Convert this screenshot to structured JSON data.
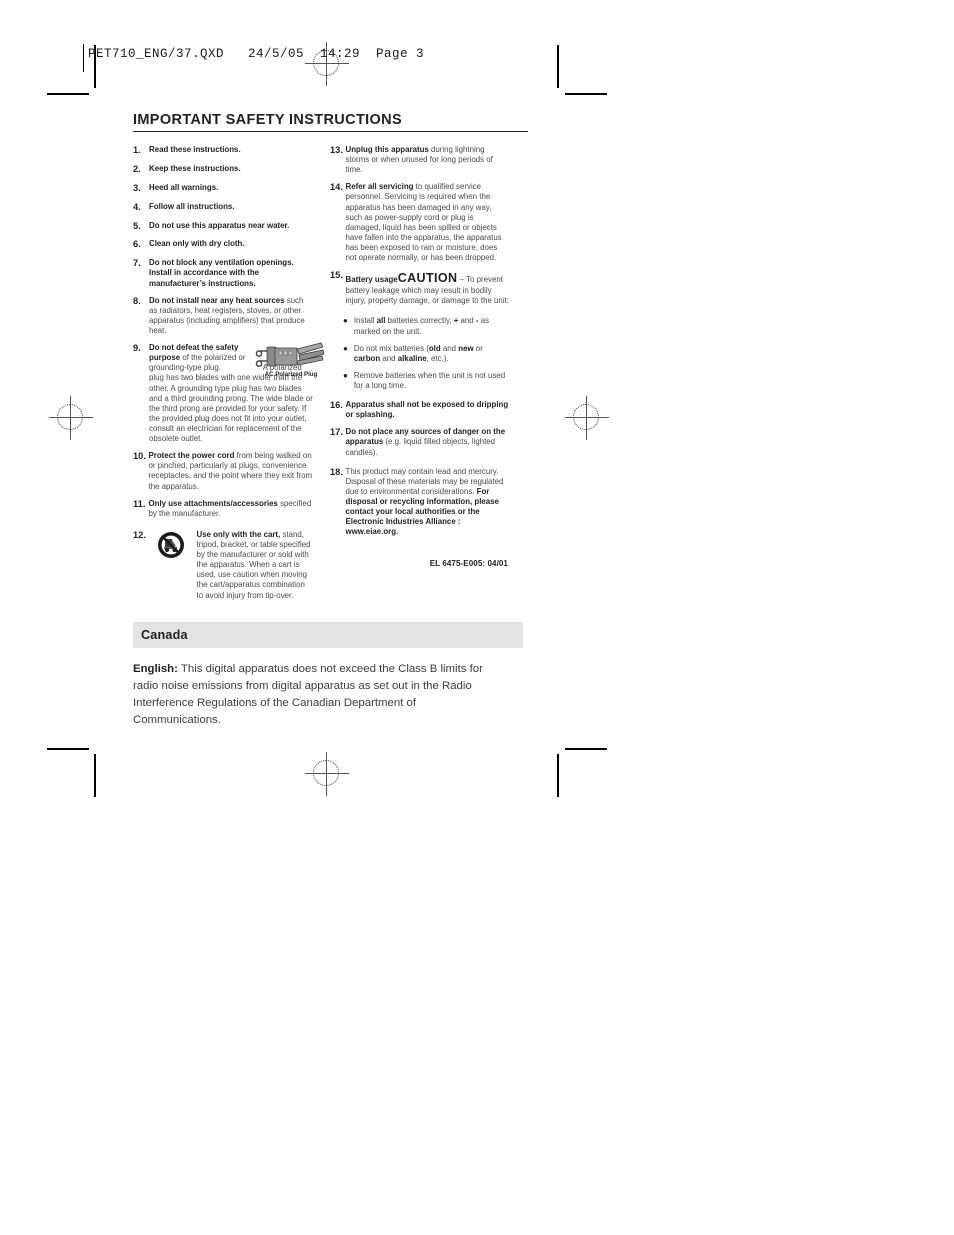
{
  "print_header": {
    "file_info": "PET710_ENG/37.QXD   24/5/05  14:29  Page 3"
  },
  "document": {
    "title": "IMPORTANT SAFETY INSTRUCTIONS",
    "left_column": [
      {
        "num": "1.",
        "bold": "Read these instructions.",
        "rest": ""
      },
      {
        "num": "2.",
        "bold": "Keep these instructions.",
        "rest": ""
      },
      {
        "num": "3.",
        "bold": "Heed all warnings.",
        "rest": ""
      },
      {
        "num": "4.",
        "bold": "Follow all instructions.",
        "rest": ""
      },
      {
        "num": "5.",
        "bold": "Do not use this apparatus near water.",
        "rest": ""
      },
      {
        "num": "6.",
        "bold": "Clean only with dry cloth.",
        "rest": ""
      },
      {
        "num": "7.",
        "bold": "Do not block any ventilation openings. Install in accordance with the manufacturer’s instructions.",
        "rest": ""
      },
      {
        "num": "8.",
        "bold": "Do not install near any heat sources",
        "rest": " such as radiators, heat registers, stoves, or other apparatus (including amplifiers) that produce heat."
      },
      {
        "num": "9.",
        "bold": "Do not defeat the safety purpose",
        "rest": " of the polarized or grounding-type plug.",
        "rest2": "A polarized plug has two blades with one wider than the other. A grounding type plug has two blades and a third grounding prong. The wide blade or the third prong are provided for your safety. If the provided plug does not fit into your outlet, consult an electrician for replacement of the obsolete outlet.",
        "figure_caption": "AC Polarized Plug",
        "figure_icon": "ac-polarized-plug-illustration"
      },
      {
        "num": "10.",
        "bold": "Protect the power cord",
        "rest": " from being walked on or pinched, particularly at plugs, convenience receptacles, and the point where they exit from the apparatus."
      },
      {
        "num": "11.",
        "bold": "Only use attachments/accessories",
        "rest": " specified by the manufacturer."
      },
      {
        "num": "12.",
        "bold": "Use only with the cart,",
        "rest": " stand, tripod, bracket, or table specified by the manufacturer or sold with the apparatus. When a cart is used, use caution when moving the cart/apparatus combination to avoid injury from tip-over.",
        "icon": "cart-tip-over-warning-icon"
      }
    ],
    "right_column": [
      {
        "num": "13.",
        "bold": "Unplug this apparatus",
        "rest": " during lightning storms or when unused for long periods of time."
      },
      {
        "num": "14.",
        "bold": "Refer all servicing",
        "rest": " to qualified service personnel. Servicing is required when the apparatus has been damaged in any way, such as power-supply cord or plug is damaged, liquid has been spilled or objects have fallen into the apparatus, the apparatus has been exposed to rain or moisture, does not operate normally, or has been dropped."
      },
      {
        "num": "15.",
        "bold": "Battery usage",
        "caution": "CAUTION",
        "rest": " – To prevent battery leakage which may result in bodily injury, property damage, or damage to the unit:"
      },
      {
        "num": "16.",
        "bold": "Apparatus shall not be exposed to dripping or splashing.",
        "rest": ""
      },
      {
        "num": "17.",
        "bold": "Do not place any sources of danger on the apparatus",
        "rest": " (e.g. liquid filled objects, lighted candles)."
      },
      {
        "num": "18.",
        "bold": "",
        "rest": "This product may contain lead and mercury. Disposal of these materials may be regulated due to environmental considerations. ",
        "bold_tail": "For disposal or recycling information, please contact your local authorities or the Electronic Industries Alliance : www.eiae.org."
      }
    ],
    "battery_bullets": [
      {
        "pre": "Install ",
        "b1": "all",
        "mid": " batteries correctly, ",
        "plus": "+",
        "mid2": " and ",
        "minus": "-",
        "post": " as marked on the unit."
      },
      {
        "pre": "Do not mix batteries (",
        "b1": "old",
        "mid": " and ",
        "b2": "new",
        "mid2": " or ",
        "b3": "carbon",
        "mid3": " and ",
        "b4": "alkaline",
        "post": ", etc.)."
      },
      {
        "pre": "Remove batteries when the unit is not used for a long time."
      }
    ],
    "bullet_glyph": "●",
    "el_code": "EL 6475-E005: 04/01"
  },
  "canada": {
    "heading": "Canada",
    "label": "English:",
    "body": " This digital apparatus does not exceed the Class B limits for radio noise emissions from digital apparatus as set out in the Radio Interference Regulations of the Canadian Department of Communications."
  }
}
